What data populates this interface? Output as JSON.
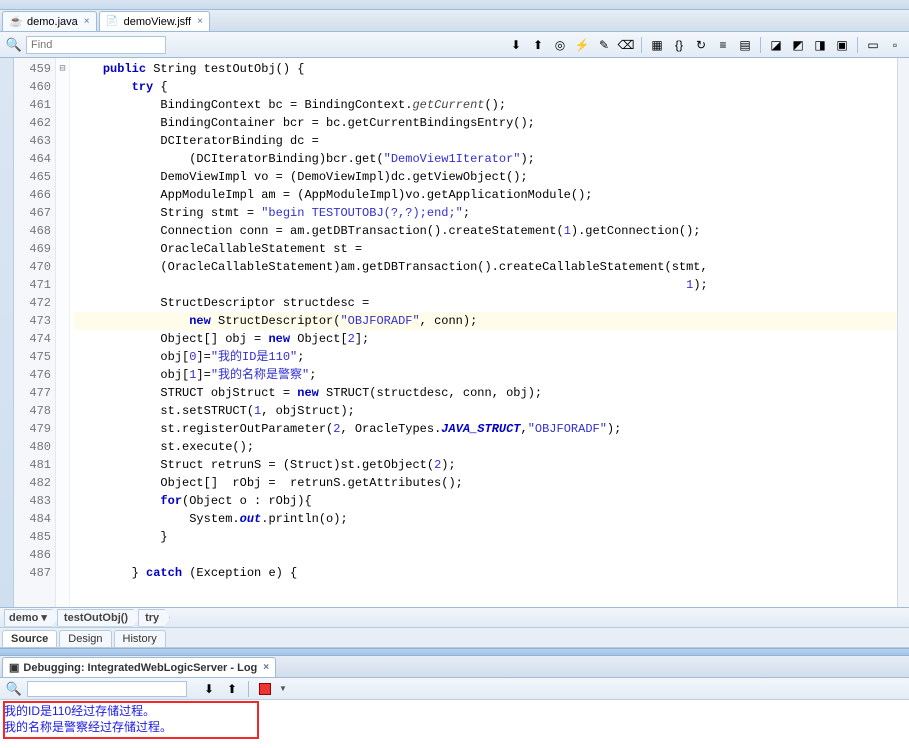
{
  "tabs": {
    "file1": {
      "name": "demo.java"
    },
    "file2": {
      "name": "demoView.jsff"
    }
  },
  "find": {
    "placeholder": "Find"
  },
  "toolbar_icons": [
    "arrow-down-icon",
    "arrow-up-icon",
    "target-icon",
    "highlight-icon",
    "pencil-icon",
    "eraser-icon",
    "sep",
    "new-section-icon",
    "braces-icon",
    "refresh-icon",
    "align-left-icon",
    "align-block-icon",
    "sep",
    "bookmark-icon",
    "bookmark-prev-icon",
    "bookmark-next-icon",
    "bookmark-toggle-icon",
    "sep",
    "panel-icon",
    "panel2-icon"
  ],
  "toolbar_glyphs": {
    "arrow-down-icon": "⬇",
    "arrow-up-icon": "⬆",
    "target-icon": "◎",
    "highlight-icon": "⚡",
    "pencil-icon": "✎",
    "eraser-icon": "⌫",
    "new-section-icon": "▦",
    "braces-icon": "{}",
    "refresh-icon": "↻",
    "align-left-icon": "≡",
    "align-block-icon": "▤",
    "bookmark-icon": "◪",
    "bookmark-prev-icon": "◩",
    "bookmark-next-icon": "◨",
    "bookmark-toggle-icon": "▣",
    "panel-icon": "▭",
    "panel2-icon": "▫"
  },
  "gutter": {
    "start": 459,
    "end": 487
  },
  "code_lines": [
    {
      "n": 459,
      "fold": "⊟",
      "segs": [
        [
          "    ",
          ""
        ],
        [
          "public",
          "kw"
        ],
        [
          " String testOutObj() {",
          ""
        ]
      ]
    },
    {
      "n": 460,
      "segs": [
        [
          "        ",
          ""
        ],
        [
          "try",
          "kw"
        ],
        [
          " {",
          ""
        ]
      ]
    },
    {
      "n": 461,
      "segs": [
        [
          "            BindingContext bc = BindingContext.",
          ""
        ],
        [
          "getCurrent",
          "ital"
        ],
        [
          "();",
          ""
        ]
      ]
    },
    {
      "n": 462,
      "segs": [
        [
          "            BindingContainer bcr = bc.getCurrentBindingsEntry();",
          ""
        ]
      ]
    },
    {
      "n": 463,
      "segs": [
        [
          "            DCIteratorBinding dc =",
          ""
        ]
      ]
    },
    {
      "n": 464,
      "segs": [
        [
          "                (DCIteratorBinding)bcr.get(",
          ""
        ],
        [
          "\"DemoView1Iterator\"",
          "str"
        ],
        [
          ");",
          ""
        ]
      ]
    },
    {
      "n": 465,
      "segs": [
        [
          "            DemoViewImpl vo = (DemoViewImpl)dc.getViewObject();",
          ""
        ]
      ]
    },
    {
      "n": 466,
      "segs": [
        [
          "            AppModuleImpl am = (AppModuleImpl)vo.getApplicationModule();",
          ""
        ]
      ]
    },
    {
      "n": 467,
      "segs": [
        [
          "            String stmt = ",
          ""
        ],
        [
          "\"begin TESTOUTOBJ(?,?);end;\"",
          "str"
        ],
        [
          ";",
          ""
        ]
      ]
    },
    {
      "n": 468,
      "segs": [
        [
          "            Connection conn = am.getDBTransaction().createStatement(",
          ""
        ],
        [
          "1",
          "num"
        ],
        [
          ").getConnection();",
          ""
        ]
      ]
    },
    {
      "n": 469,
      "segs": [
        [
          "            OracleCallableStatement st =",
          ""
        ]
      ]
    },
    {
      "n": 470,
      "segs": [
        [
          "            (OracleCallableStatement)am.getDBTransaction().createCallableStatement(stmt,",
          ""
        ]
      ]
    },
    {
      "n": 471,
      "segs": [
        [
          "                                                                                     ",
          ""
        ],
        [
          "1",
          "num"
        ],
        [
          ");",
          ""
        ]
      ]
    },
    {
      "n": 472,
      "segs": [
        [
          "            StructDescriptor structdesc =",
          ""
        ]
      ]
    },
    {
      "n": 473,
      "hl": true,
      "segs": [
        [
          "                ",
          ""
        ],
        [
          "new",
          "kw"
        ],
        [
          " StructDescriptor(",
          ""
        ],
        [
          "\"OBJFORADF\"",
          "str"
        ],
        [
          ", conn);",
          ""
        ]
      ]
    },
    {
      "n": 474,
      "segs": [
        [
          "            Object[] obj = ",
          ""
        ],
        [
          "new",
          "kw"
        ],
        [
          " Object[",
          ""
        ],
        [
          "2",
          "num"
        ],
        [
          "];",
          ""
        ]
      ]
    },
    {
      "n": 475,
      "segs": [
        [
          "            obj[",
          ""
        ],
        [
          "0",
          "num"
        ],
        [
          "]=",
          ""
        ],
        [
          "\"我的ID是110\"",
          "str"
        ],
        [
          ";",
          ""
        ]
      ]
    },
    {
      "n": 476,
      "segs": [
        [
          "            obj[",
          ""
        ],
        [
          "1",
          "num"
        ],
        [
          "]=",
          ""
        ],
        [
          "\"我的名称是警察\"",
          "str"
        ],
        [
          ";",
          ""
        ]
      ]
    },
    {
      "n": 477,
      "segs": [
        [
          "            STRUCT objStruct = ",
          ""
        ],
        [
          "new",
          "kw"
        ],
        [
          " STRUCT(structdesc, conn, obj);",
          ""
        ]
      ]
    },
    {
      "n": 478,
      "segs": [
        [
          "            st.setSTRUCT(",
          ""
        ],
        [
          "1",
          "num"
        ],
        [
          ", objStruct);",
          ""
        ]
      ]
    },
    {
      "n": 479,
      "segs": [
        [
          "            st.registerOutParameter(",
          ""
        ],
        [
          "2",
          "num"
        ],
        [
          ", OracleTypes.",
          ""
        ],
        [
          "JAVA_STRUCT",
          "ital2"
        ],
        [
          ",",
          ""
        ],
        [
          "\"OBJFORADF\"",
          "str"
        ],
        [
          ");",
          ""
        ]
      ]
    },
    {
      "n": 480,
      "segs": [
        [
          "            st.execute();",
          ""
        ]
      ]
    },
    {
      "n": 481,
      "segs": [
        [
          "            Struct retrunS = (Struct)st.getObject(",
          ""
        ],
        [
          "2",
          "num"
        ],
        [
          ");",
          ""
        ]
      ]
    },
    {
      "n": 482,
      "segs": [
        [
          "            Object[]  rObj =  retrunS.getAttributes();",
          ""
        ]
      ]
    },
    {
      "n": 483,
      "segs": [
        [
          "            ",
          ""
        ],
        [
          "for",
          "kw"
        ],
        [
          "(Object o : rObj){",
          ""
        ]
      ]
    },
    {
      "n": 484,
      "segs": [
        [
          "                System.",
          ""
        ],
        [
          "out",
          "ital2"
        ],
        [
          ".println(o);",
          ""
        ]
      ]
    },
    {
      "n": 485,
      "segs": [
        [
          "            }",
          ""
        ]
      ]
    },
    {
      "n": 486,
      "segs": [
        [
          "",
          ""
        ]
      ]
    },
    {
      "n": 487,
      "segs": [
        [
          "        } ",
          ""
        ],
        [
          "catch",
          "kw"
        ],
        [
          " (Exception e) {",
          ""
        ]
      ]
    }
  ],
  "breadcrumb": {
    "c1": "demo ▾",
    "c2": "testOutObj()",
    "c3": "try"
  },
  "lower_tabs": {
    "t1": "Source",
    "t2": "Design",
    "t3": "History"
  },
  "log": {
    "title": "Debugging: IntegratedWebLogicServer - Log",
    "line1": "我的ID是110经过存储过程。",
    "line2": "我的名称是警察经过存储过程。"
  }
}
